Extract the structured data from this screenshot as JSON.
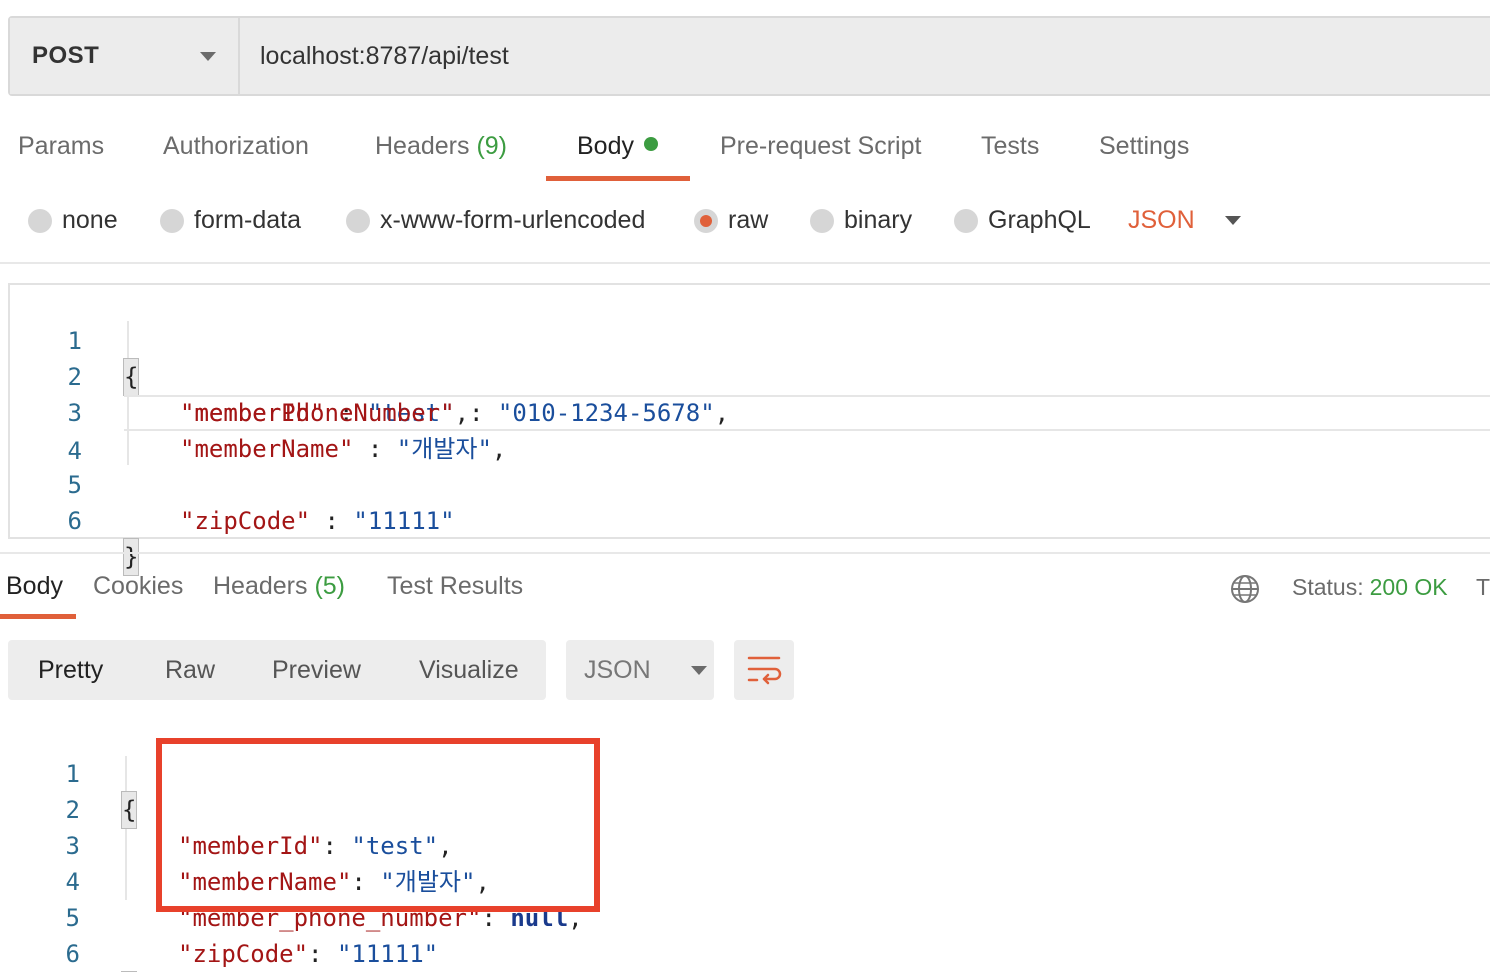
{
  "request": {
    "method": "POST",
    "url": "localhost:8787/api/test"
  },
  "request_tabs": {
    "params": "Params",
    "authorization": "Authorization",
    "headers": "Headers",
    "headers_count": "(9)",
    "body": "Body",
    "pre_request": "Pre-request Script",
    "tests": "Tests",
    "settings": "Settings"
  },
  "body_types": {
    "none": "none",
    "form_data": "form-data",
    "urlencoded": "x-www-form-urlencoded",
    "raw": "raw",
    "binary": "binary",
    "graphql": "GraphQL",
    "selected": "raw",
    "format": "JSON"
  },
  "request_body": {
    "line_numbers": [
      "1",
      "2",
      "3",
      "4",
      "5",
      "6"
    ],
    "open": "{",
    "close": "}",
    "lines": [
      {
        "key": "\"memberId\"",
        "sep": " : ",
        "value": "\"test\"",
        "tail": ","
      },
      {
        "key": "\"memberName\"",
        "sep": " : ",
        "value": "\"개발자\"",
        "tail": ","
      },
      {
        "key": "\"memberPhoneNumber\"",
        "sep": " : ",
        "value": "\"010-1234-5678\"",
        "tail": ","
      },
      {
        "key": "\"zipCode\"",
        "sep": " : ",
        "value": "\"11111\"",
        "tail": ""
      }
    ]
  },
  "response_tabs": {
    "body": "Body",
    "cookies": "Cookies",
    "headers": "Headers",
    "headers_count": "(5)",
    "test_results": "Test Results",
    "status_label": "Status:",
    "status_value": "200 OK",
    "truncated": "T"
  },
  "view_modes": {
    "pretty": "Pretty",
    "raw": "Raw",
    "preview": "Preview",
    "visualize": "Visualize",
    "format": "JSON"
  },
  "response_body": {
    "line_numbers": [
      "1",
      "2",
      "3",
      "4",
      "5",
      "6"
    ],
    "open": "{",
    "close": "}",
    "lines": [
      {
        "key": "\"memberId\"",
        "sep": ": ",
        "value": "\"test\"",
        "tail": ","
      },
      {
        "key": "\"memberName\"",
        "sep": ": ",
        "value": "\"개발자\"",
        "tail": ","
      },
      {
        "key": "\"member_phone_number\"",
        "sep": ": ",
        "value": "null",
        "tail": ","
      },
      {
        "key": "\"zipCode\"",
        "sep": ": ",
        "value": "\"11111\"",
        "tail": ""
      }
    ]
  },
  "colors": {
    "accent": "#e0603a",
    "success": "#3c9c41",
    "highlight_box": "#e8412b",
    "json_key": "#a31515",
    "json_string": "#1a4e9c"
  }
}
